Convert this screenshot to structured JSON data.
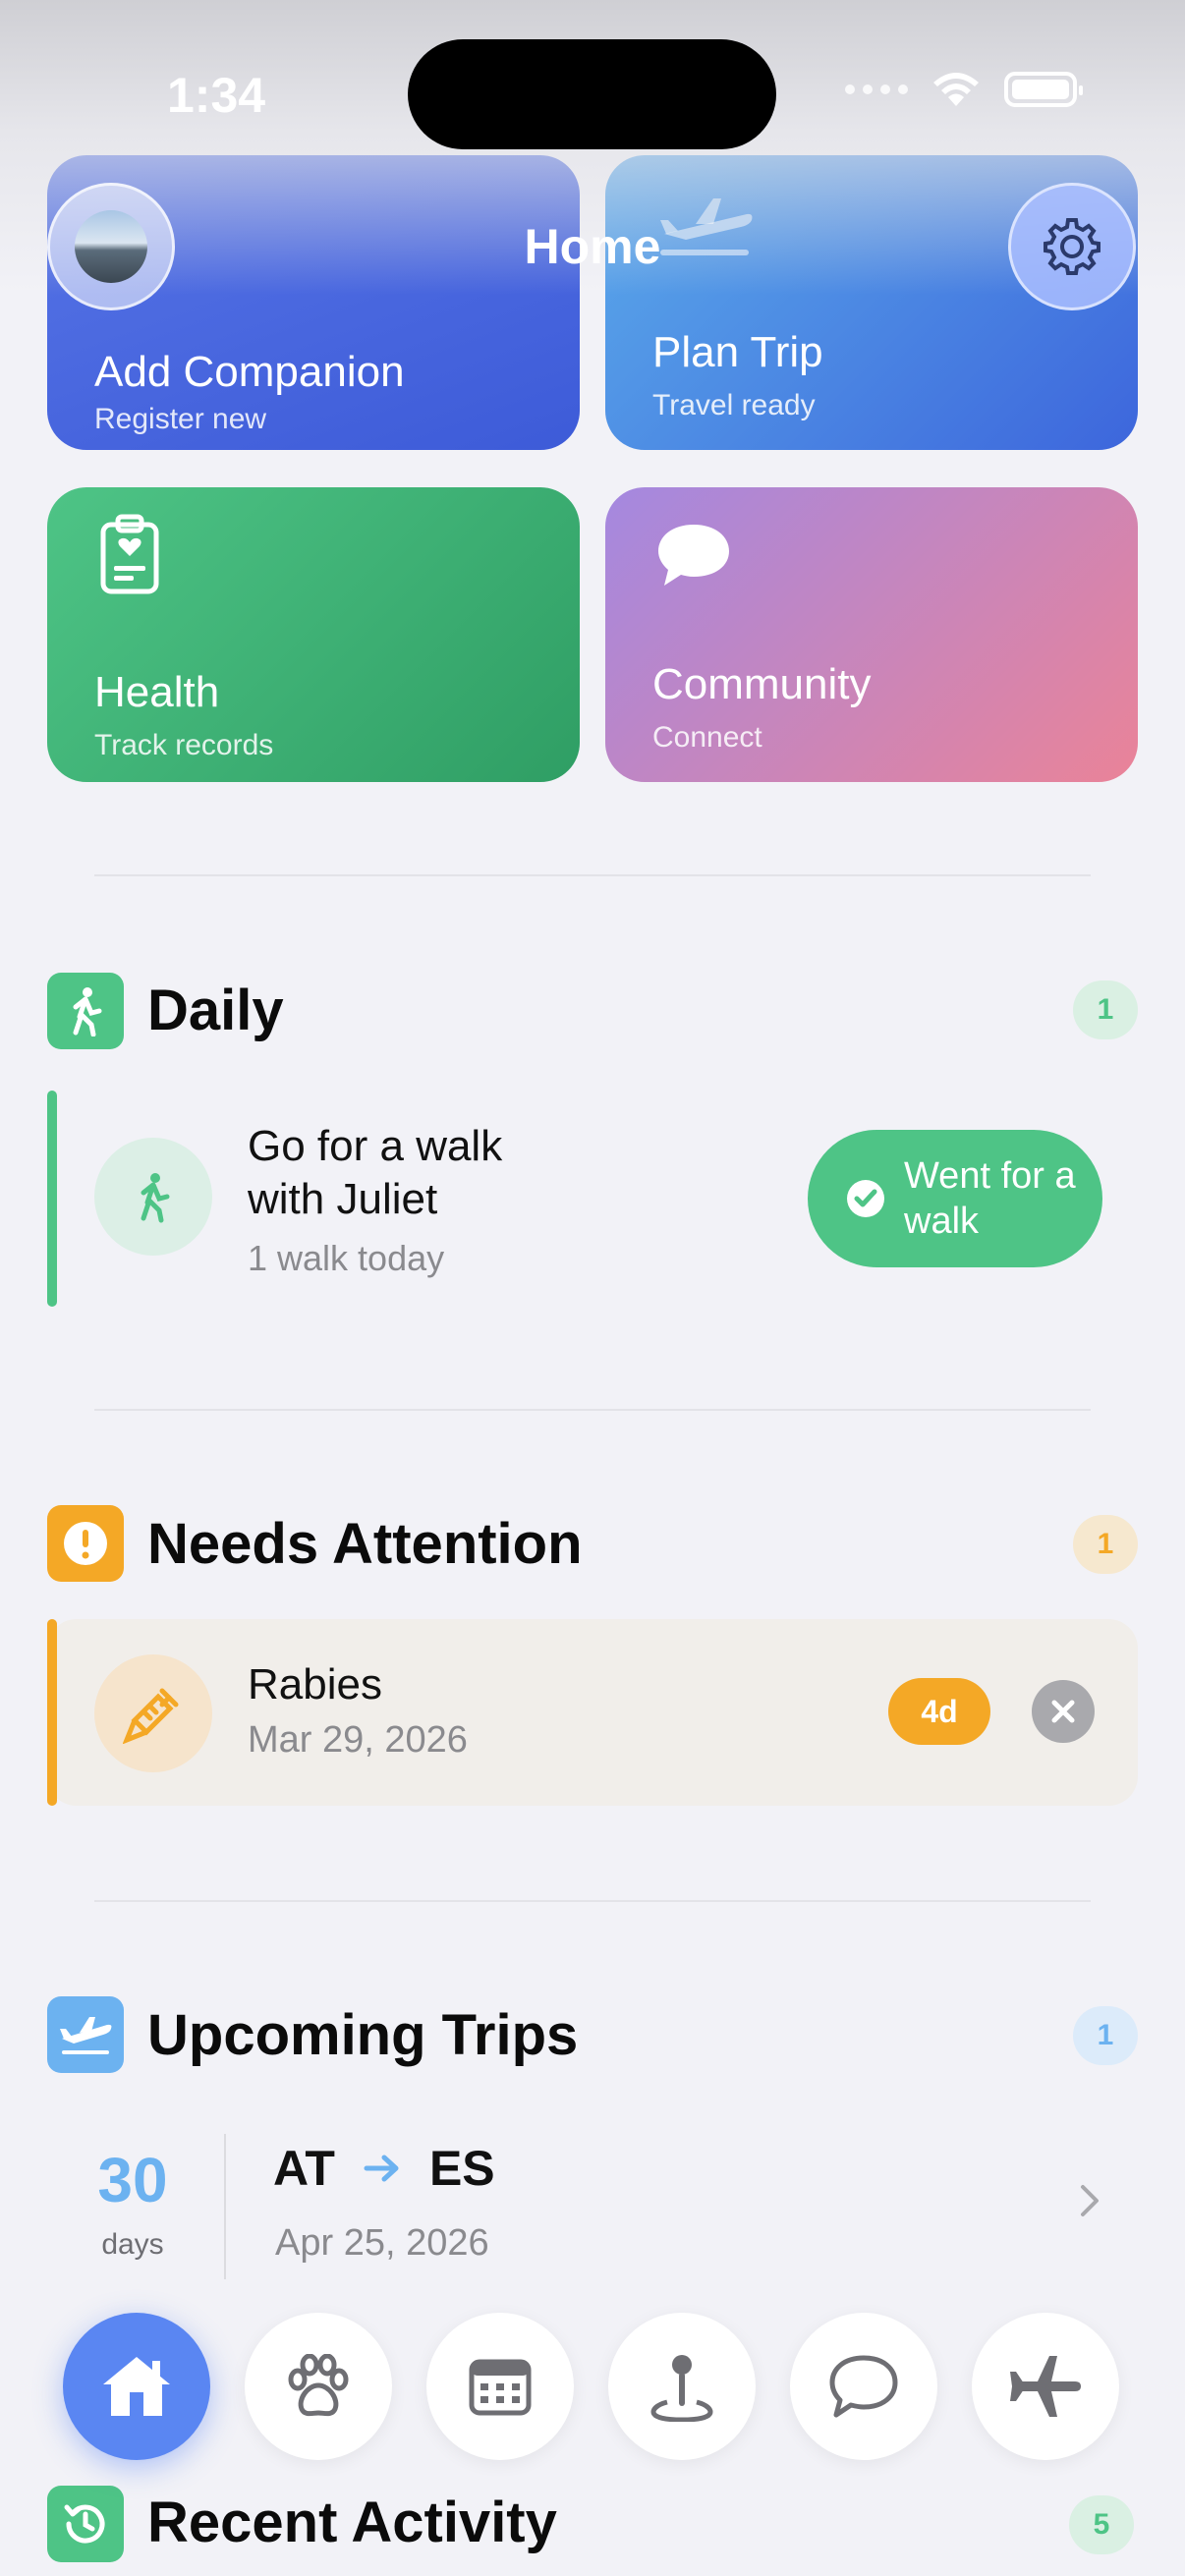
{
  "status_bar": {
    "time": "1:34"
  },
  "header": {
    "title": "Home"
  },
  "tiles": [
    {
      "title": "Add Companion",
      "subtitle": "Register new"
    },
    {
      "title": "Plan Trip",
      "subtitle": "Travel ready"
    },
    {
      "title": "Health",
      "subtitle": "Track records"
    },
    {
      "title": "Community",
      "subtitle": "Connect"
    }
  ],
  "daily": {
    "title": "Daily",
    "count": "1",
    "task_title": "Go for a walk with Juliet",
    "task_subtitle": "1 walk today",
    "action_label": "Went for a walk"
  },
  "attention": {
    "title": "Needs Attention",
    "count": "1",
    "item_title": "Rabies",
    "item_date": "Mar 29, 2026",
    "item_badge": "4d"
  },
  "trips": {
    "title": "Upcoming Trips",
    "count": "1",
    "days_value": "30",
    "days_label": "days",
    "from": "AT",
    "to": "ES",
    "date": "Apr 25, 2026"
  },
  "recent": {
    "title": "Recent Activity",
    "count": "5"
  },
  "nav": {
    "items": [
      "home-icon",
      "paw-icon",
      "calendar-icon",
      "map-pin-icon",
      "chat-icon",
      "airplane-icon"
    ],
    "active_index": 0
  },
  "colors": {
    "green": "#4EC486",
    "orange": "#F4A826",
    "blue": "#6CB2F0",
    "accent": "#5A86F2",
    "background": "#F2F2F7"
  }
}
